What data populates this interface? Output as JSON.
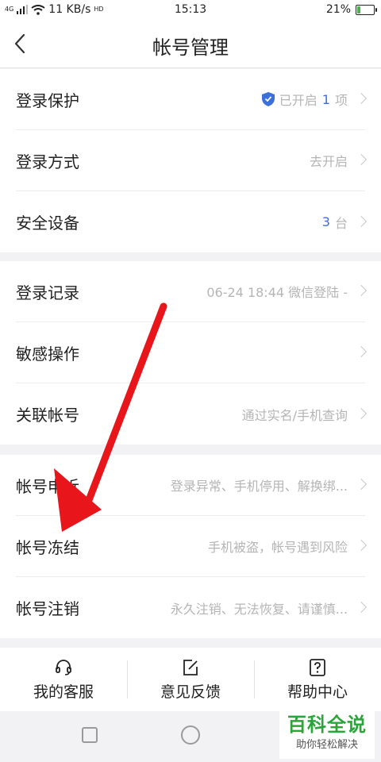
{
  "status_bar": {
    "signal_label": "4G",
    "network_speed": "11 KB/s",
    "hd_badge": "HD",
    "time": "15:13",
    "battery_percent": "21%",
    "battery_level": 0.21
  },
  "header": {
    "title": "帐号管理"
  },
  "group1": {
    "rows": [
      {
        "label": "登录保护",
        "value_prefix": "已开启",
        "value_number": "1",
        "value_suffix": "项"
      },
      {
        "label": "登录方式",
        "value": "去开启"
      },
      {
        "label": "安全设备",
        "value_number": "3",
        "value_suffix": "台"
      }
    ]
  },
  "group2": {
    "rows": [
      {
        "label": "登录记录",
        "value": "06-24 18:44 微信登陆 -"
      },
      {
        "label": "敏感操作",
        "value": ""
      },
      {
        "label": "关联帐号",
        "value": "通过实名/手机查询"
      }
    ]
  },
  "group3": {
    "rows": [
      {
        "label": "帐号申诉",
        "value": "登录异常、手机停用、解换绑..."
      },
      {
        "label": "帐号冻结",
        "value": "手机被盗，帐号遇到风险"
      },
      {
        "label": "帐号注销",
        "value": "永久注销、无法恢复、请谨慎..."
      }
    ]
  },
  "bottom_bar": {
    "items": [
      {
        "label": "我的客服",
        "icon": "headset-icon"
      },
      {
        "label": "意见反馈",
        "icon": "feedback-edit-icon"
      },
      {
        "label": "帮助中心",
        "icon": "help-question-icon"
      }
    ]
  },
  "watermark": {
    "title": "百科全说",
    "subtitle": "助你轻松解决"
  },
  "colors": {
    "accent_blue": "#3a6fdc",
    "annotation_arrow": "#e8161b",
    "watermark_green": "#2aa53a"
  }
}
